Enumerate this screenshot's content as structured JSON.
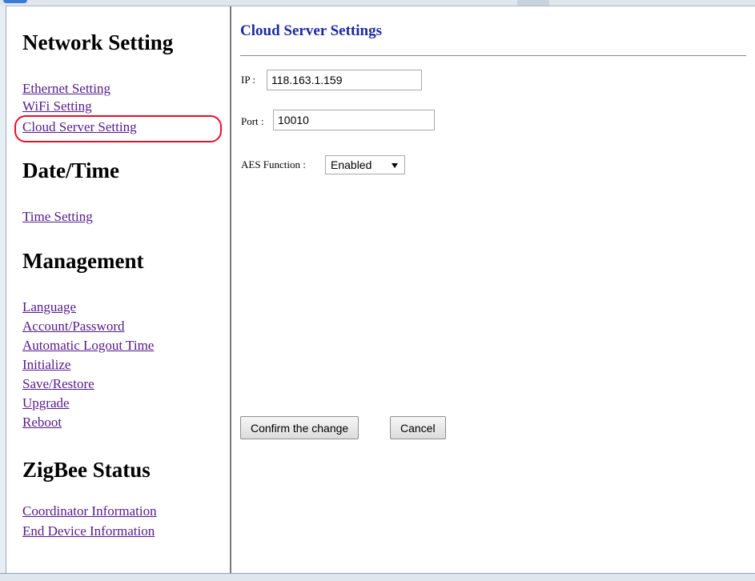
{
  "sidebar": {
    "sections": [
      {
        "title": "Network Setting",
        "links": [
          "Ethernet Setting",
          "WiFi Setting",
          "Cloud Server Setting"
        ]
      },
      {
        "title": "Date/Time",
        "links": [
          "Time Setting"
        ]
      },
      {
        "title": "Management",
        "links": [
          "Language",
          "Account/Password",
          "Automatic Logout Time",
          "Initialize",
          "Save/Restore",
          "Upgrade",
          "Reboot"
        ]
      },
      {
        "title": "ZigBee Status",
        "links": [
          "Coordinator Information",
          "End Device Information"
        ]
      }
    ],
    "highlighted_link": "Cloud Server Setting",
    "link_color": "#551a8b",
    "highlight_color": "#e8102a"
  },
  "main": {
    "title": "Cloud Server Settings",
    "title_color": "#1a2aa0",
    "ip": {
      "label": "IP :",
      "value": "118.163.1.159"
    },
    "port": {
      "label": "Port :",
      "value": "10010"
    },
    "aes": {
      "label": "AES Function :",
      "value": "Enabled",
      "icon": "chevron-down-icon"
    },
    "buttons": {
      "confirm": "Confirm the change",
      "cancel": "Cancel"
    }
  }
}
